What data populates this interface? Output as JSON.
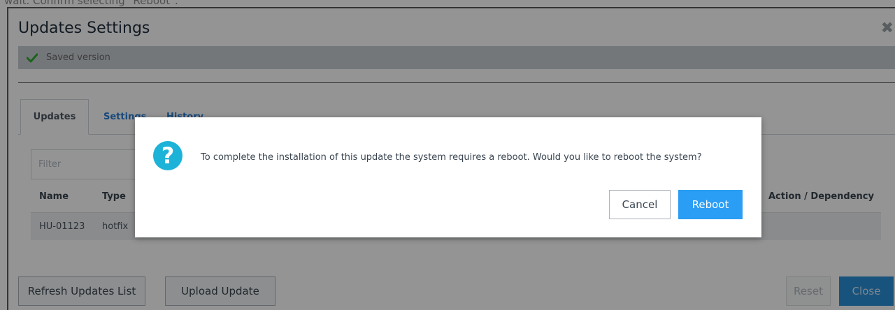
{
  "caption": "wait. Confirm selecting \"Reboot\".",
  "window": {
    "title": "Updates Settings",
    "close_glyph": "✖",
    "status_message": "Saved version"
  },
  "tabs": [
    {
      "label": "Updates"
    },
    {
      "label": "Settings"
    },
    {
      "label": "History"
    }
  ],
  "filter": {
    "placeholder": "Filter"
  },
  "table": {
    "headers": {
      "name": "Name",
      "type": "Type",
      "action": "Action / Dependency"
    },
    "rows": [
      {
        "name": "HU-01123",
        "type": "hotfix"
      }
    ]
  },
  "footer": {
    "refresh": "Refresh Updates List",
    "upload": "Upload Update",
    "reset": "Reset",
    "close": "Close"
  },
  "dialog": {
    "icon_glyph": "?",
    "message": "To complete the installation of this update the system requires a reboot. Would you like to reboot the system?",
    "cancel": "Cancel",
    "confirm": "Reboot"
  },
  "colors": {
    "accent": "#2a9df4",
    "question_icon": "#1db3d8",
    "success_check": "#2eab2e"
  }
}
